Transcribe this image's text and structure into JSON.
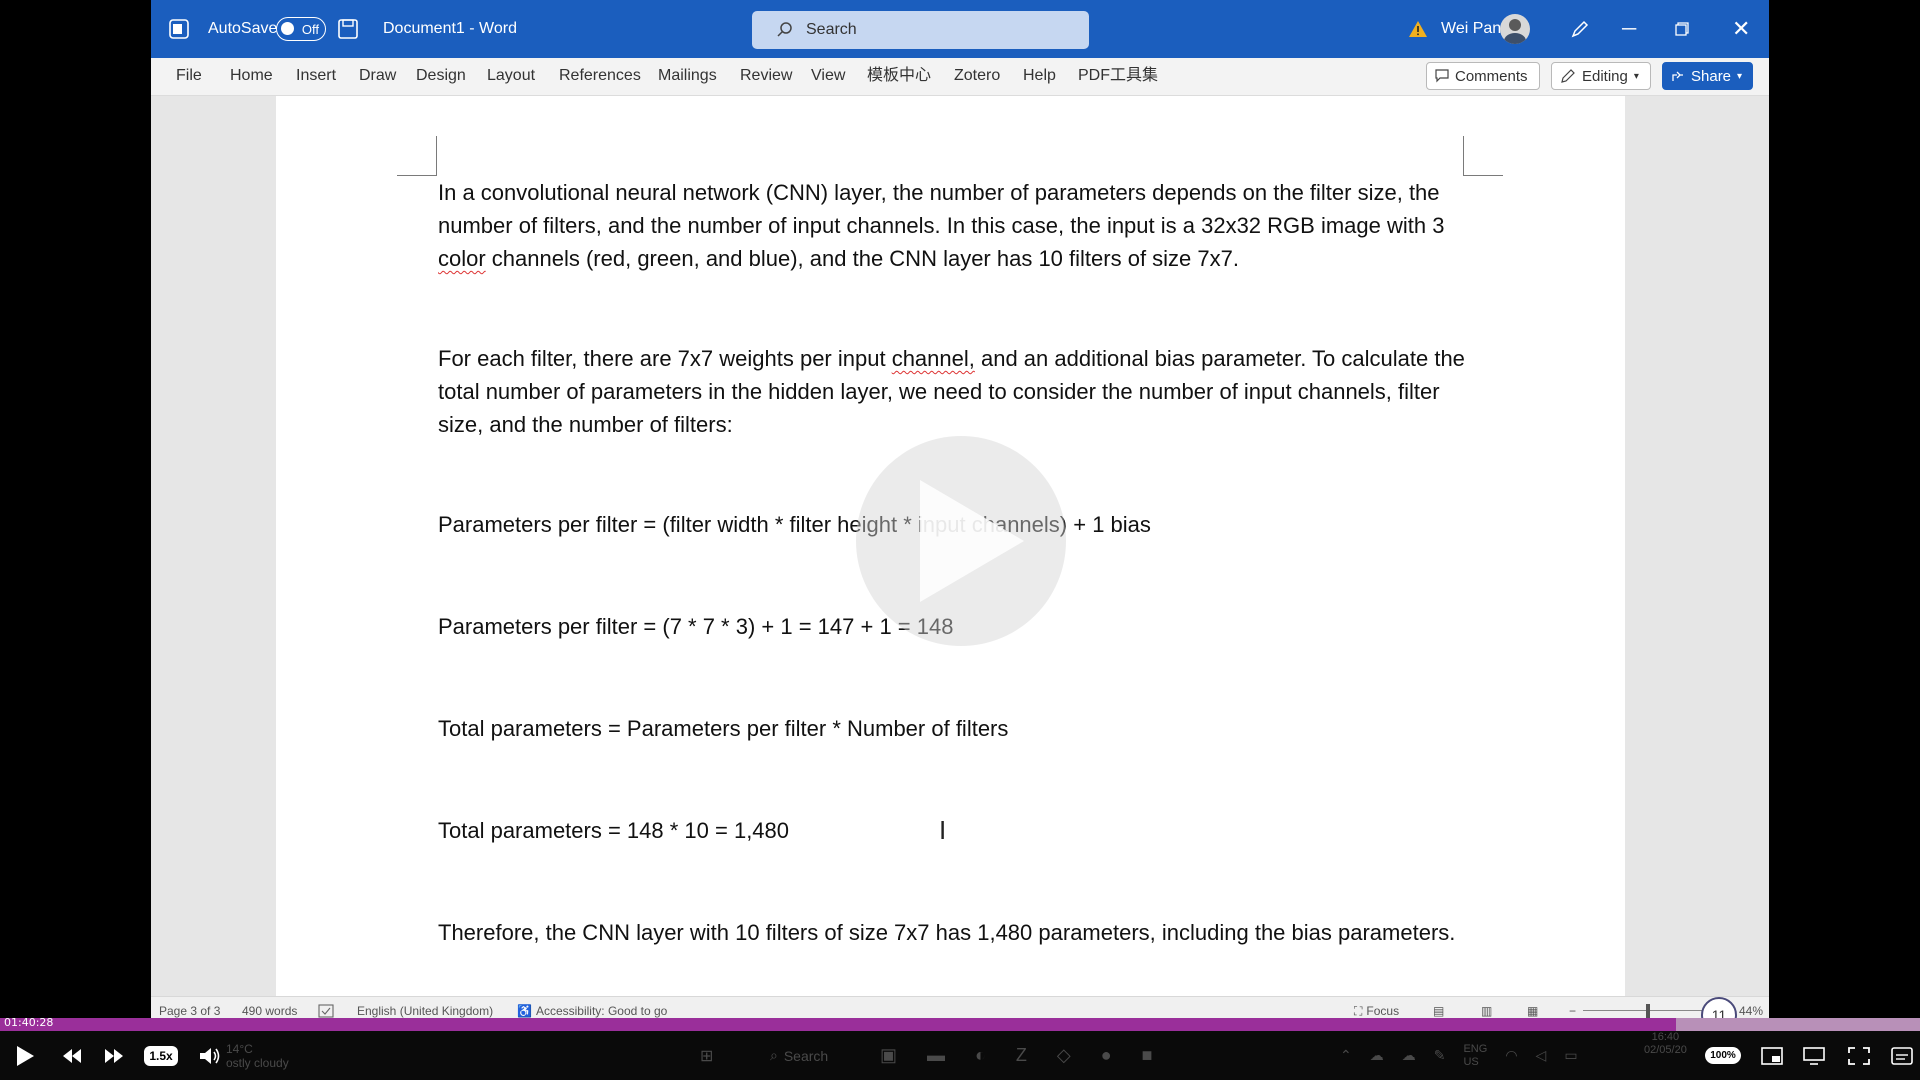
{
  "titlebar": {
    "autosave_label": "AutoSave",
    "autosave_state": "Off",
    "doc_title": "Document1  -  Word",
    "search_placeholder": "Search",
    "user_name": "Wei Pan",
    "accent_color": "#1b5ebe"
  },
  "ribbon": {
    "tabs": [
      "File",
      "Home",
      "Insert",
      "Draw",
      "Design",
      "Layout",
      "References",
      "Mailings",
      "Review",
      "View",
      "模板中心",
      "Zotero",
      "Help",
      "PDF工具集"
    ],
    "comments_label": "Comments",
    "editing_label": "Editing",
    "share_label": "Share"
  },
  "document": {
    "p1_a": "In a convolutional neural network (CNN) layer, the number of parameters depends on the filter size, the number of filters, and the number of input channels. In this case, the input is a 32x32 RGB image with 3 ",
    "p1_sq": "color",
    "p1_b": " channels (red, green, and blue), and the CNN layer has 10 filters of size 7x7.",
    "p2_a": "For each filter, there are 7x7 weights per input ",
    "p2_sq": "channel,",
    "p2_b": " and an additional bias parameter. To calculate the total number of parameters in the hidden layer, we need to consider the number of input channels, filter size, and the number of filters:",
    "p3": "Parameters per filter = (filter width * filter height * input channels) + 1 bias",
    "p4": "Parameters per filter = (7 * 7 * 3) + 1 = 147 + 1 = 148",
    "p5": "Total parameters = Parameters per filter * Number of filters",
    "p6": "Total parameters = 148 * 10 = 1,480",
    "p7": "Therefore, the CNN layer with 10 filters of size 7x7 has 1,480 parameters, including the bias parameters."
  },
  "statusbar": {
    "page": "Page 3 of 3",
    "words": "490 words",
    "language": "English (United Kingdom)",
    "accessibility": "Accessibility: Good to go",
    "focus": "Focus",
    "zoom_percent": "44%",
    "zoom_circle": "11"
  },
  "player": {
    "timecode": "01:40:28",
    "speed": "1.5x",
    "volume_badge": "100%",
    "progress_fraction": 0.873
  },
  "taskbar": {
    "weather_temp": "14°C",
    "weather_desc": "ostly cloudy",
    "search_label": "Search",
    "lang_line1": "ENG",
    "lang_line2": "US",
    "clock_time": "16:40",
    "clock_date": "02/05/20"
  }
}
